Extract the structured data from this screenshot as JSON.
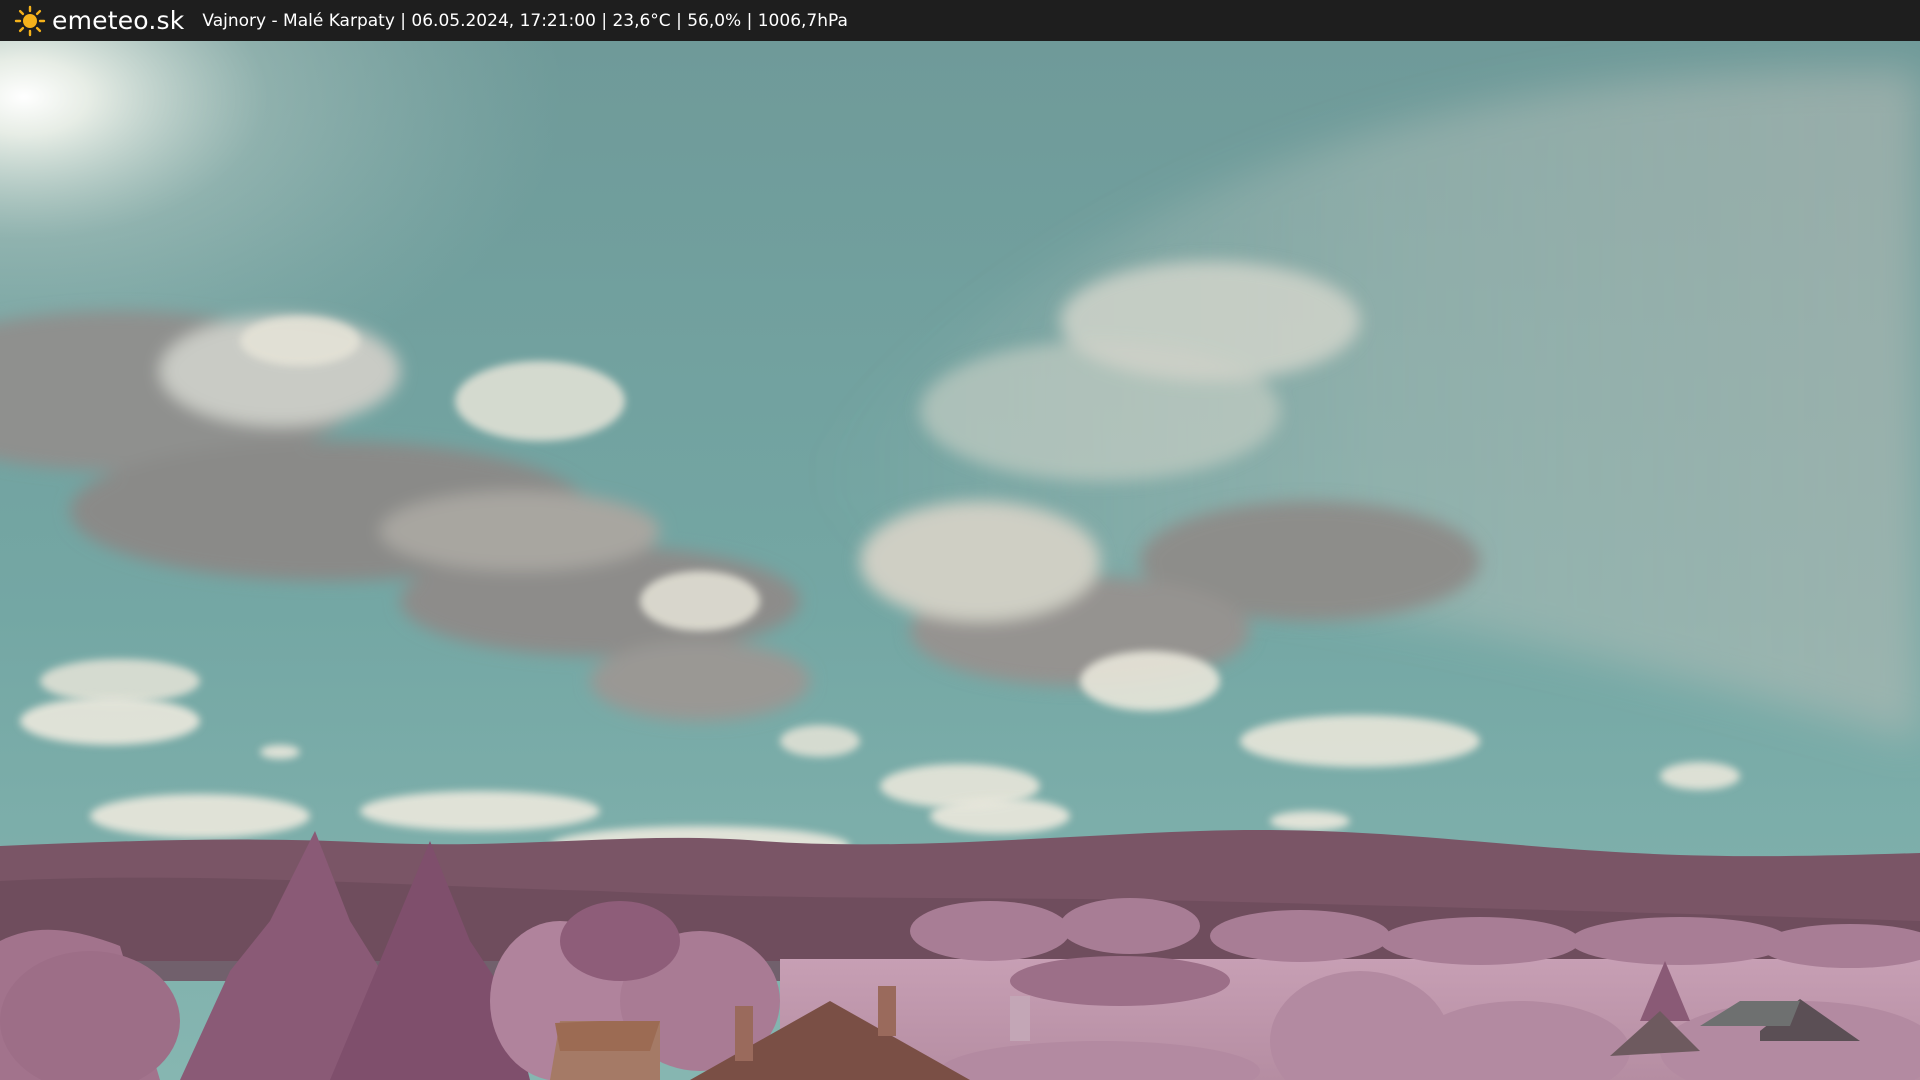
{
  "header": {
    "logo_icon": "sun-icon",
    "brand": "emeteo.sk",
    "caption": "Vajnory - Malé Karpaty | 06.05.2024, 17:21:00 | 23,6°C | 56,0% | 1006,7hPa"
  },
  "colors": {
    "bar": "#1e1e1e",
    "sun": "#f5b21b",
    "sky_top": "#6f9a99",
    "sky_bottom": "#7fb2ae",
    "hills": "#7a5566",
    "foliage": "#b78aa3"
  }
}
